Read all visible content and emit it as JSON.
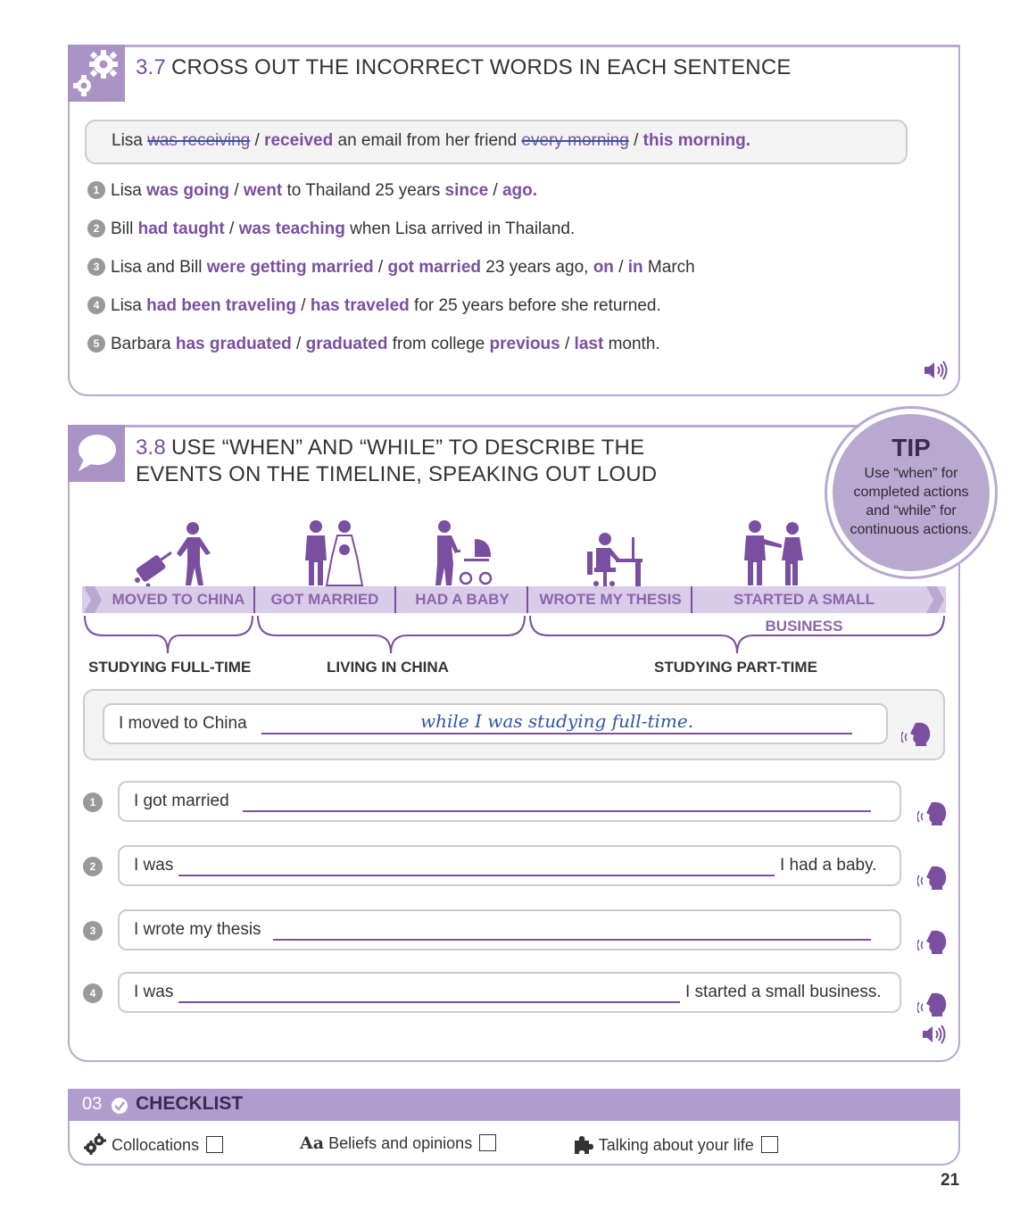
{
  "ex37": {
    "number": "3.7",
    "title": "CROSS OUT THE INCORRECT WORDS IN EACH SENTENCE",
    "example": {
      "w1": "Lisa ",
      "struck1": "was receiving",
      "w2": " / ",
      "correct1": "received",
      "w3": " an email from her friend ",
      "struck2": "every morning",
      "w4": " / ",
      "correct2": "this morning."
    },
    "items": [
      {
        "n": "1",
        "parts": [
          "Lisa ",
          "was going",
          " / ",
          "went",
          " to Thailand 25 years ",
          "since",
          " / ",
          "ago."
        ]
      },
      {
        "n": "2",
        "parts": [
          "Bill ",
          "had taught",
          " / ",
          "was teaching",
          " when Lisa arrived in Thailand.",
          "",
          "",
          ""
        ]
      },
      {
        "n": "3",
        "parts": [
          "Lisa and Bill ",
          "were getting married",
          " / ",
          "got married",
          " 23 years ago, ",
          "on",
          " / ",
          "in",
          " March"
        ]
      },
      {
        "n": "4",
        "parts": [
          "Lisa ",
          "had been traveling",
          " / ",
          "has traveled",
          " for 25 years before she returned.",
          "",
          "",
          ""
        ]
      },
      {
        "n": "5",
        "parts": [
          "Barbara ",
          "has graduated",
          " / ",
          "graduated",
          " from college ",
          "previous",
          " / ",
          "last",
          " month."
        ]
      }
    ]
  },
  "ex38": {
    "number": "3.8",
    "title_line1": "USE “WHEN” AND “WHILE” TO DESCRIBE THE",
    "title_line2": "EVENTS ON THE TIMELINE, SPEAKING OUT LOUD",
    "tip": {
      "title": "TIP",
      "text": "Use “when” for completed actions and “while” for continuous actions."
    },
    "timeline": [
      "MOVED TO CHINA",
      "GOT MARRIED",
      "HAD A BABY",
      "WROTE MY THESIS",
      "STARTED A SMALL BUSINESS"
    ],
    "periods": [
      "STUDYING FULL-TIME",
      "LIVING IN CHINA",
      "STUDYING PART-TIME"
    ],
    "example": {
      "prefix": "I moved to China",
      "answer": "while I was studying full-time."
    },
    "items": [
      {
        "n": "1",
        "prefix": "I got married",
        "suffix": ""
      },
      {
        "n": "2",
        "prefix": "I was",
        "suffix": "I had a baby."
      },
      {
        "n": "3",
        "prefix": "I wrote my thesis",
        "suffix": ""
      },
      {
        "n": "4",
        "prefix": "I was",
        "suffix": "I started a small business."
      }
    ]
  },
  "checklist": {
    "unit": "03",
    "title": "CHECKLIST",
    "items": [
      {
        "icon": "gears-icon",
        "label": "Collocations"
      },
      {
        "icon": "aa-icon",
        "prefix": "Aa",
        "label": "Beliefs and opinions"
      },
      {
        "icon": "puzzle-icon",
        "label": "Talking about your life"
      }
    ]
  },
  "page_number": "21",
  "colors": {
    "accent": "#7a4f9f",
    "panel_border": "#b9a8d0",
    "timeline_bg": "#d9cce8",
    "handwriting": "#2e55a8"
  }
}
